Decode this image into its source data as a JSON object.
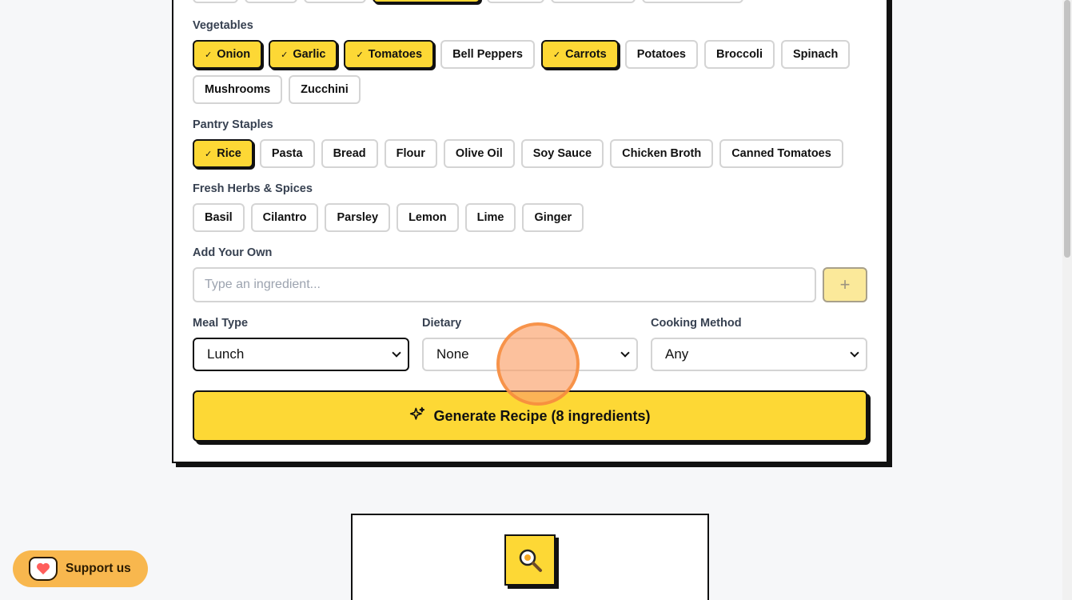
{
  "top_partial_chips": [
    "",
    "",
    "",
    "",
    "",
    "",
    ""
  ],
  "vegetables": {
    "label": "Vegetables",
    "items": [
      {
        "label": "Onion",
        "selected": true
      },
      {
        "label": "Garlic",
        "selected": true
      },
      {
        "label": "Tomatoes",
        "selected": true
      },
      {
        "label": "Bell Peppers",
        "selected": false
      },
      {
        "label": "Carrots",
        "selected": true
      },
      {
        "label": "Potatoes",
        "selected": false
      },
      {
        "label": "Broccoli",
        "selected": false
      },
      {
        "label": "Spinach",
        "selected": false
      },
      {
        "label": "Mushrooms",
        "selected": false
      },
      {
        "label": "Zucchini",
        "selected": false
      }
    ]
  },
  "pantry": {
    "label": "Pantry Staples",
    "items": [
      {
        "label": "Rice",
        "selected": true
      },
      {
        "label": "Pasta",
        "selected": false
      },
      {
        "label": "Bread",
        "selected": false
      },
      {
        "label": "Flour",
        "selected": false
      },
      {
        "label": "Olive Oil",
        "selected": false
      },
      {
        "label": "Soy Sauce",
        "selected": false
      },
      {
        "label": "Chicken Broth",
        "selected": false
      },
      {
        "label": "Canned Tomatoes",
        "selected": false
      }
    ]
  },
  "herbs": {
    "label": "Fresh Herbs & Spices",
    "items": [
      {
        "label": "Basil",
        "selected": false
      },
      {
        "label": "Cilantro",
        "selected": false
      },
      {
        "label": "Parsley",
        "selected": false
      },
      {
        "label": "Lemon",
        "selected": false
      },
      {
        "label": "Lime",
        "selected": false
      },
      {
        "label": "Ginger",
        "selected": false
      }
    ]
  },
  "add_own": {
    "label": "Add Your Own",
    "placeholder": "Type an ingredient...",
    "value": "",
    "add_icon": "plus-icon"
  },
  "filters": {
    "meal_type": {
      "label": "Meal Type",
      "value": "Lunch"
    },
    "dietary": {
      "label": "Dietary",
      "value": "None"
    },
    "cooking_method": {
      "label": "Cooking Method",
      "value": "Any"
    }
  },
  "generate": {
    "label": "Generate Recipe (8 ingredients)",
    "icon": "sparkles-icon"
  },
  "support": {
    "label": "Support us",
    "icon": "ko-fi-cup-icon"
  },
  "logo_icon": "magnifier-egg-icon",
  "colors": {
    "accent": "#fdd835",
    "border": "#111111",
    "support": "#f8b74e",
    "cursor": "#fba069"
  }
}
